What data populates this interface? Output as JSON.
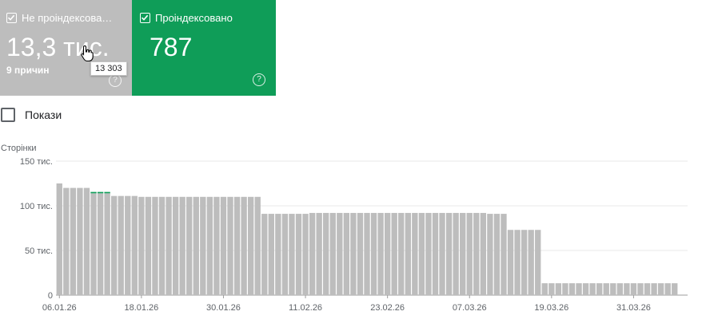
{
  "cards": {
    "not_indexed": {
      "label": "Не проіндексова…",
      "value": "13,3 тис.",
      "sub": "9 причин",
      "color": "#bdbdbd",
      "checked": true,
      "help_glyph": "?"
    },
    "indexed": {
      "label": "Проіндексовано",
      "value": "787",
      "color": "#0f9d58",
      "checked": true,
      "help_glyph": "?"
    }
  },
  "tooltip": {
    "text": "13 303"
  },
  "show_toggle": {
    "label": "Покази",
    "checked": false
  },
  "chart_data": {
    "type": "bar",
    "ylabel": "Сторінки",
    "ylim": [
      0,
      150000
    ],
    "y_ticks": [
      0,
      50000,
      100000,
      150000
    ],
    "y_tick_labels": [
      "0",
      "50 тис.",
      "100 тис.",
      "150 тис."
    ],
    "x_tick_labels": [
      "06.01.26",
      "18.01.26",
      "30.01.26",
      "11.02.26",
      "23.02.26",
      "07.03.26",
      "19.03.26",
      "31.03.26"
    ],
    "grid": true,
    "series": [
      {
        "color": "#bdbdbd",
        "values": [
          125000,
          120000,
          120000,
          120000,
          120000,
          114000,
          114000,
          114000,
          111000,
          111000,
          111000,
          111000,
          110000,
          110000,
          110000,
          110000,
          110000,
          110000,
          110000,
          110000,
          110000,
          110000,
          110000,
          110000,
          110000,
          110000,
          110000,
          110000,
          110000,
          110000,
          91000,
          91000,
          91000,
          91000,
          91000,
          91000,
          91000,
          92000,
          92000,
          92000,
          92000,
          92000,
          92000,
          92000,
          92000,
          92000,
          92000,
          92000,
          92000,
          92000,
          92000,
          92000,
          92000,
          92000,
          92000,
          92000,
          92000,
          92000,
          92000,
          92000,
          92000,
          92000,
          92000,
          91000,
          91000,
          91000,
          73000,
          73000,
          73000,
          73000,
          73000,
          13300,
          13300,
          13300,
          13300,
          13300,
          13300,
          13300,
          13300,
          13300,
          13300,
          13300,
          13300,
          13300,
          13300,
          13300,
          13300,
          13300,
          13300,
          13300,
          13300
        ]
      },
      {
        "color": "#0f9d58",
        "values": [
          0,
          0,
          0,
          0,
          0,
          1500,
          1500,
          1500,
          0,
          0,
          0,
          0,
          0,
          0,
          0,
          0,
          0,
          0,
          0,
          0,
          0,
          0,
          0,
          0,
          0,
          0,
          0,
          0,
          0,
          0,
          0,
          0,
          0,
          0,
          0,
          0,
          0,
          0,
          0,
          0,
          0,
          0,
          0,
          0,
          0,
          0,
          0,
          0,
          0,
          0,
          0,
          0,
          0,
          0,
          0,
          0,
          0,
          0,
          0,
          0,
          0,
          0,
          0,
          0,
          0,
          0,
          0,
          0,
          0,
          0,
          0,
          0,
          0,
          0,
          0,
          0,
          0,
          0,
          0,
          0,
          0,
          0,
          0,
          0,
          0,
          0,
          0,
          0,
          0,
          0,
          0
        ]
      }
    ]
  }
}
